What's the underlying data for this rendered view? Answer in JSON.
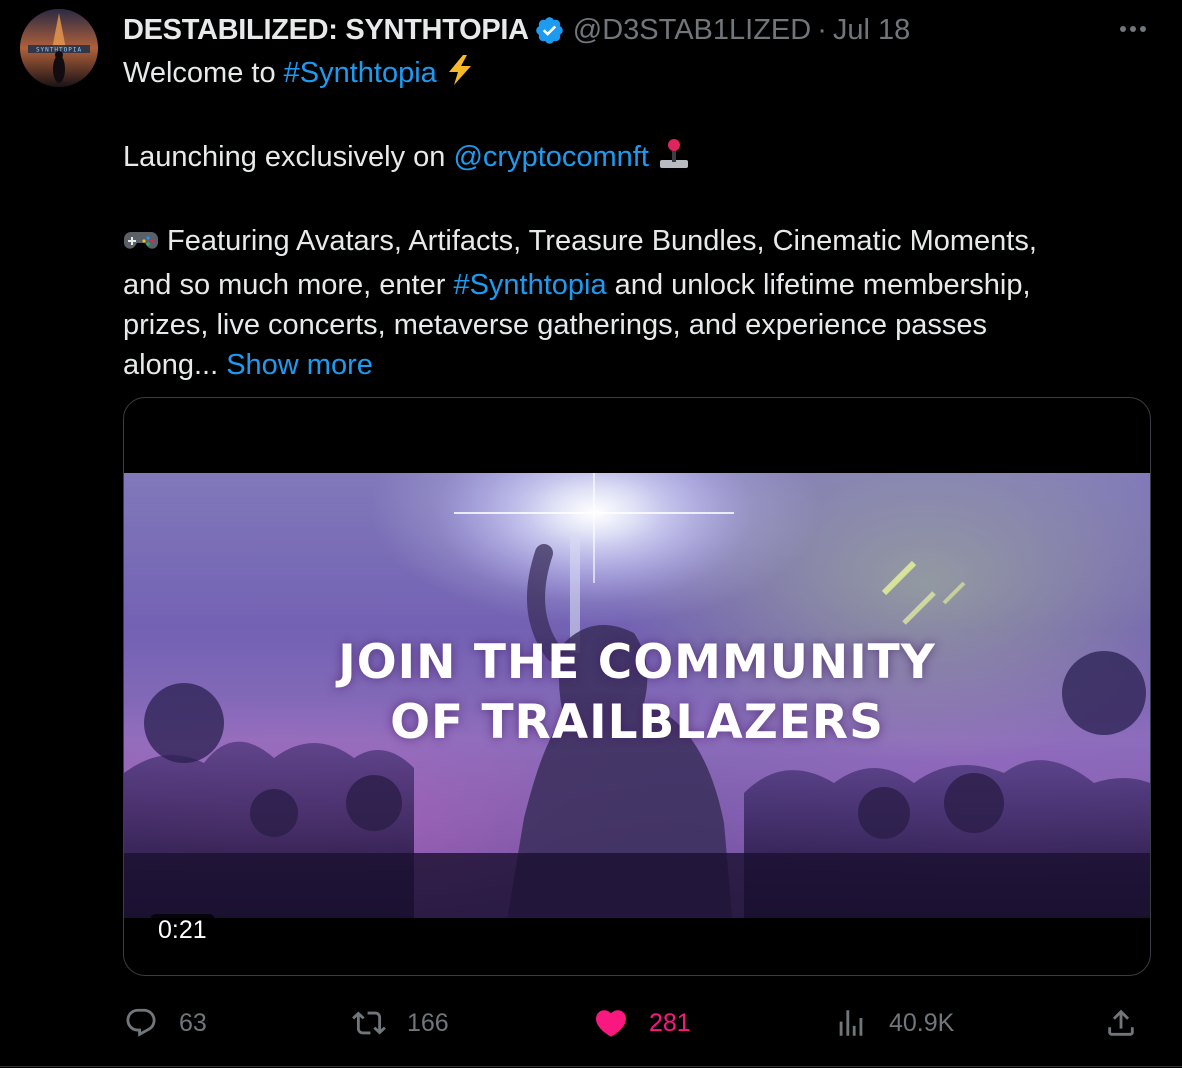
{
  "author": {
    "display_name": "DESTABILIZED: SYNTHTOPIA",
    "handle": "@D3STAB1LIZED",
    "separator": "·",
    "date": "Jul 18",
    "verified": true,
    "avatar_text": "SYNTHTOPIA"
  },
  "tweet": {
    "line1_prefix": "Welcome to ",
    "line1_hashtag": "#Synthtopia",
    "line1_emoji": "⚡",
    "line2_prefix": "Launching exclusively on ",
    "line2_mention": "@cryptocomnft",
    "line2_emoji": "joystick-icon",
    "line3_emoji": "gamepad-icon",
    "line3_text": " Featuring Avatars, Artifacts, Treasure Bundles, Cinematic Moments,",
    "line4_prefix": "and so much more, enter ",
    "line4_hashtag": "#Synthtopia",
    "line4_suffix": " and unlock lifetime membership,",
    "line5_text": "prizes, live concerts, metaverse gatherings, and experience passes",
    "line6_text": "along... ",
    "show_more": "Show more"
  },
  "media": {
    "overlay_line1": "JOIN THE COMMUNITY",
    "overlay_line2": "OF TRAILBLAZERS",
    "duration": "0:21"
  },
  "actions": {
    "replies": "63",
    "retweets": "166",
    "likes": "281",
    "views": "40.9K"
  },
  "colors": {
    "background": "#000000",
    "text": "#e7e9ea",
    "muted": "#71767b",
    "link": "#1d9bf0",
    "like": "#f91880",
    "verified": "#1d9bf0"
  }
}
